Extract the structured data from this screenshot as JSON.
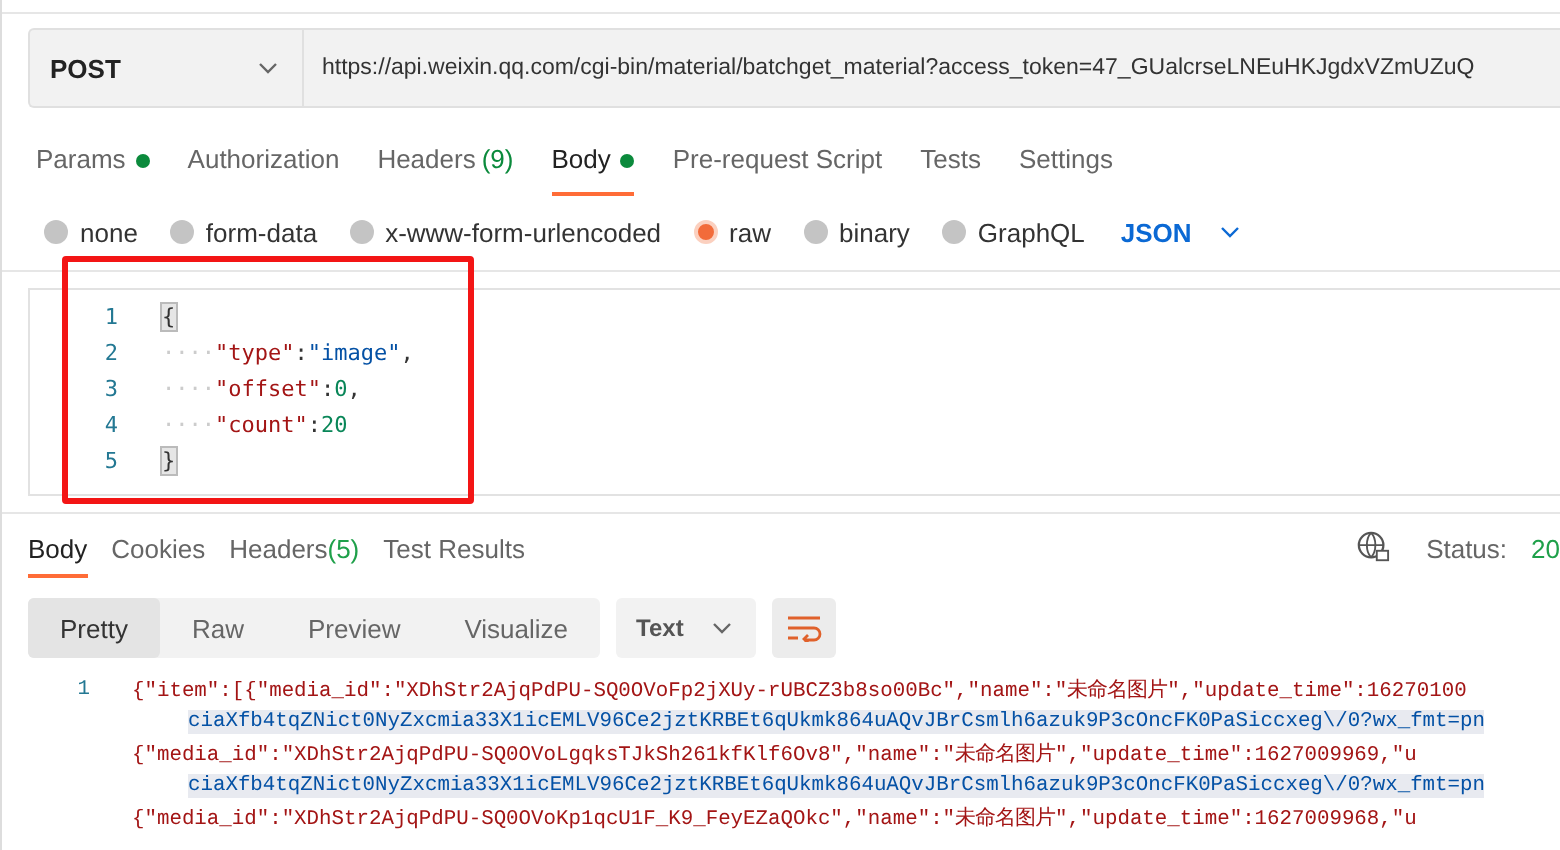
{
  "request": {
    "method": "POST",
    "url": "https://api.weixin.qq.com/cgi-bin/material/batchget_material?access_token=47_GUalcrseLNEuHKJgdxVZmUZuQ"
  },
  "tabs": [
    {
      "label": "Params",
      "dot": true,
      "selected": false
    },
    {
      "label": "Authorization",
      "dot": false,
      "selected": false
    },
    {
      "label": "Headers",
      "count": "(9)",
      "dot": false,
      "selected": false
    },
    {
      "label": "Body",
      "dot": true,
      "selected": true
    },
    {
      "label": "Pre-request Script",
      "dot": false,
      "selected": false
    },
    {
      "label": "Tests",
      "dot": false,
      "selected": false
    },
    {
      "label": "Settings",
      "dot": false,
      "selected": false
    }
  ],
  "body_types": [
    {
      "label": "none",
      "selected": false
    },
    {
      "label": "form-data",
      "selected": false
    },
    {
      "label": "x-www-form-urlencoded",
      "selected": false
    },
    {
      "label": "raw",
      "selected": true
    },
    {
      "label": "binary",
      "selected": false
    },
    {
      "label": "GraphQL",
      "selected": false
    }
  ],
  "language": "JSON",
  "editor": {
    "lines": [
      {
        "number": "1",
        "tokens": [
          {
            "kind": "brace",
            "text": "{"
          }
        ]
      },
      {
        "number": "2",
        "indent": "····",
        "tokens": [
          {
            "kind": "key",
            "text": "\"type\""
          },
          {
            "kind": "punct",
            "text": ":"
          },
          {
            "kind": "string",
            "text": "\"image\""
          },
          {
            "kind": "punct",
            "text": ","
          }
        ]
      },
      {
        "number": "3",
        "indent": "····",
        "tokens": [
          {
            "kind": "key",
            "text": "\"offset\""
          },
          {
            "kind": "punct",
            "text": ":"
          },
          {
            "kind": "number",
            "text": "0"
          },
          {
            "kind": "punct",
            "text": ","
          }
        ]
      },
      {
        "number": "4",
        "indent": "····",
        "tokens": [
          {
            "kind": "key",
            "text": "\"count\""
          },
          {
            "kind": "punct",
            "text": ":"
          },
          {
            "kind": "number",
            "text": "20"
          }
        ]
      },
      {
        "number": "5",
        "tokens": [
          {
            "kind": "brace",
            "text": "}"
          }
        ]
      }
    ]
  },
  "response_tabs": [
    {
      "label": "Body",
      "selected": true
    },
    {
      "label": "Cookies",
      "selected": false
    },
    {
      "label": "Headers",
      "count": "(5)",
      "selected": false
    },
    {
      "label": "Test Results",
      "selected": false
    }
  ],
  "status": {
    "label": "Status:",
    "value": "20"
  },
  "view_modes": [
    {
      "label": "Pretty",
      "selected": true
    },
    {
      "label": "Raw",
      "selected": false
    },
    {
      "label": "Preview",
      "selected": false
    },
    {
      "label": "Visualize",
      "selected": false
    }
  ],
  "format": "Text",
  "response": {
    "lines": [
      {
        "number": "1",
        "kind": "object",
        "highlighted": false,
        "text": "{\"item\":[{\"media_id\":\"XDhStr2AjqPdPU-SQ0OVoFp2jXUy-rUBCZ3b8so00Bc\",\"name\":\"未命名图片\",\"update_time\":16270100"
      },
      {
        "kind": "string",
        "highlighted": true,
        "text": "ciaXfb4tqZNict0NyZxcmia33X1icEMLV96Ce2jztKRBEt6qUkmk864uAQvJBrCsmlh6azuk9P3cOncFK0PaSiccxeg\\/0?wx_fmt=pn"
      },
      {
        "kind": "object",
        "highlighted": false,
        "text": "{\"media_id\":\"XDhStr2AjqPdPU-SQ0OVoLgqksTJkSh261kfKlf6Ov8\",\"name\":\"未命名图片\",\"update_time\":1627009969,\"u"
      },
      {
        "kind": "string",
        "highlighted": true,
        "text": "ciaXfb4tqZNict0NyZxcmia33X1icEMLV96Ce2jztKRBEt6qUkmk864uAQvJBrCsmlh6azuk9P3cOncFK0PaSiccxeg\\/0?wx_fmt=pn"
      },
      {
        "kind": "object",
        "highlighted": false,
        "text": "{\"media_id\":\"XDhStr2AjqPdPU-SQ0OVoKp1qcU1F_K9_FeyEZaQOkc\",\"name\":\"未命名图片\",\"update_time\":1627009968,\"u"
      }
    ]
  }
}
